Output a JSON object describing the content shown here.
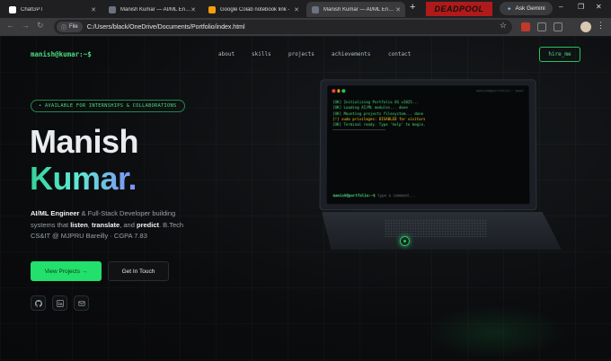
{
  "browser": {
    "tabs": [
      {
        "title": "ChatGPT",
        "color": "#ffffff"
      },
      {
        "title": "Manish Kumar — AI/ML Engineer",
        "color": "#6b7280"
      },
      {
        "title": "Google Colab notebook link -",
        "color": "#f59e0b"
      },
      {
        "title": "Manish Kumar — AI/ML Engineer",
        "color": "#6b7280"
      }
    ],
    "new_tab": "+",
    "deadpool_text": "DEADPOOL",
    "gemini_label": "Ask Gemini",
    "window_controls": [
      "–",
      "❐",
      "✕"
    ],
    "chip_label": "File",
    "url": "C:/Users/black/OneDrive/Documents/Portfolio/index.html"
  },
  "page": {
    "brand": "manish@kumar:~$",
    "nav": [
      "about",
      "skills",
      "projects",
      "achievements",
      "contact"
    ],
    "hire_label": "hire_me",
    "badge": "• AVAILABLE FOR INTERNSHIPS & COLLABORATIONS",
    "name_line1": "Manish",
    "name_line2": "Kumar.",
    "desc": {
      "role": "AI/ML Engineer",
      "t1": " & Full-Stack Developer building systems that ",
      "listen": "listen",
      "t2": ", ",
      "translate": "translate",
      "t3": ", and ",
      "predict": "predict",
      "t4": ". B.Tech CS&IT @ MJPRU Bareilly · CGPA 7.83"
    },
    "primary_button": "View Projects →",
    "secondary_button": "Get In Touch",
    "socials": [
      "github-icon",
      "linkedin-icon",
      "mail-icon"
    ]
  },
  "terminal": {
    "title": "manish@portfolio:~ bash",
    "lines": [
      "[OK] Initializing Portfolio OS v2025...",
      "[OK] Loading AI/ML modules... done",
      "[OK] Mounting projects filesystem... done",
      "[!] sudo privileges: DISABLED for visitors",
      "[OK] Terminal ready. Type 'help' to begin.",
      "────────────────────────"
    ],
    "prompt": "manish@portfolio:~$",
    "placeholder": "type a command..."
  },
  "colors": {
    "accent": "#22e06b",
    "accent_text": "#4ade80"
  }
}
